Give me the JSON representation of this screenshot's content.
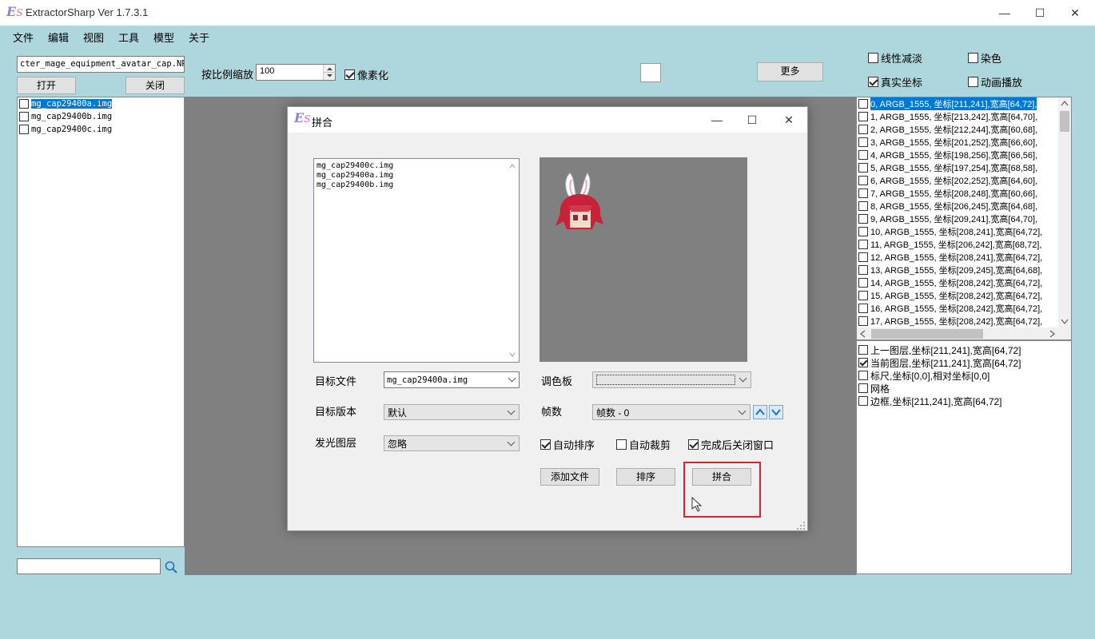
{
  "window": {
    "title": "ExtractorSharp Ver 1.7.3.1",
    "logo": "E",
    "logo_sub": "S",
    "minimize": "—",
    "maximize": "☐",
    "close": "✕"
  },
  "menu": [
    "文件",
    "编辑",
    "视图",
    "工具",
    "模型",
    "关于"
  ],
  "left": {
    "path_value": "cter_mage_equipment_avatar_cap.NPK",
    "open_label": "打开",
    "close_label": "关闭",
    "files": [
      "mg_cap29400a.img",
      "mg_cap29400b.img",
      "mg_cap29400c.img"
    ],
    "search_value": ""
  },
  "toolbar": {
    "scale_label": "按比例缩放",
    "scale_value": "100",
    "pixelate_label": "像素化",
    "more_label": "更多"
  },
  "right": {
    "linear_fade_label": "线性减淡",
    "dye_label": "染色",
    "real_coords_label": "真实坐标",
    "animate_label": "动画播放",
    "frames": [
      "0, ARGB_1555, 坐标[211,241],宽高[64,72],",
      "1, ARGB_1555, 坐标[213,242],宽高[64,70],",
      "2, ARGB_1555, 坐标[212,244],宽高[60,68],",
      "3, ARGB_1555, 坐标[201,252],宽高[66,60],",
      "4, ARGB_1555, 坐标[198,256],宽高[66,56],",
      "5, ARGB_1555, 坐标[197,254],宽高[68,58],",
      "6, ARGB_1555, 坐标[202,252],宽高[64,60],",
      "7, ARGB_1555, 坐标[208,248],宽高[60,66],",
      "8, ARGB_1555, 坐标[206,245],宽高[64,68],",
      "9, ARGB_1555, 坐标[209,241],宽高[64,70],",
      "10, ARGB_1555, 坐标[208,241],宽高[64,72],",
      "11, ARGB_1555, 坐标[206,242],宽高[68,72],",
      "12, ARGB_1555, 坐标[208,241],宽高[64,72],",
      "13, ARGB_1555, 坐标[209,245],宽高[64,68],",
      "14, ARGB_1555, 坐标[208,242],宽高[64,72],",
      "15, ARGB_1555, 坐标[208,242],宽高[64,72],",
      "16, ARGB_1555, 坐标[208,242],宽高[64,72],",
      "17, ARGB_1555, 坐标[208,242],宽高[64,72],"
    ],
    "layers": [
      {
        "label": "上一图层,坐标[211,241],宽高[64,72]",
        "checked": false
      },
      {
        "label": "当前图层,坐标[211,241],宽高[64,72]",
        "checked": true
      },
      {
        "label": "标尺,坐标[0,0],相对坐标[0,0]",
        "checked": false
      },
      {
        "label": "网格",
        "checked": false
      },
      {
        "label": "边框,坐标[211,241],宽高[64,72]",
        "checked": false
      }
    ]
  },
  "dialog": {
    "title": "拼合",
    "logo": "E",
    "logo_sub": "S",
    "file_list": [
      "mg_cap29400c.img",
      "mg_cap29400a.img",
      "mg_cap29400b.img"
    ],
    "target_file_label": "目标文件",
    "target_file_value": "mg_cap29400a.img",
    "target_version_label": "目标版本",
    "target_version_value": "默认",
    "glow_layer_label": "发光图层",
    "glow_layer_value": "忽略",
    "palette_label": "调色板",
    "palette_value": "",
    "frames_label": "帧数",
    "frames_value": "帧数 - 0",
    "auto_sort_label": "自动排序",
    "auto_crop_label": "自动裁剪",
    "close_after_label": "完成后关闭窗口",
    "add_file_label": "添加文件",
    "sort_label": "排序",
    "merge_label": "拼合"
  },
  "colors": {
    "background": "#aed7dd",
    "selection": "#0078d7",
    "highlight": "#e0212b",
    "canvas": "#808080"
  }
}
